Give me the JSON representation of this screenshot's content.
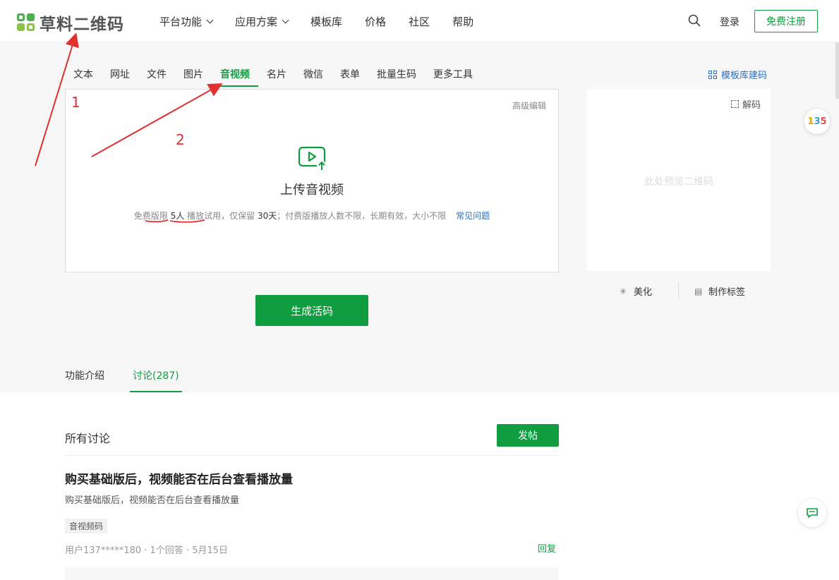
{
  "header": {
    "logo_text": "草料二维码",
    "nav": [
      {
        "label": "平台功能",
        "dropdown": true
      },
      {
        "label": "应用方案",
        "dropdown": true
      },
      {
        "label": "模板库",
        "dropdown": false
      },
      {
        "label": "价格",
        "dropdown": false
      },
      {
        "label": "社区",
        "dropdown": false
      },
      {
        "label": "帮助",
        "dropdown": false
      }
    ],
    "login": "登录",
    "register": "免费注册"
  },
  "type_tabs": [
    "文本",
    "网址",
    "文件",
    "图片",
    "音视频",
    "名片",
    "微信",
    "表单",
    "批量生码",
    "更多工具"
  ],
  "active_type_tab": "音视频",
  "template_link": "模板库建码",
  "upload": {
    "advanced_edit": "高级编辑",
    "title": "上传音视频",
    "note_prefix": "免费版限",
    "note_count": "5人",
    "note_rest": "播放试用，仅保留",
    "note_days": "30天",
    "note_paid": "；付费版播放人数不限，长期有效，大小不限",
    "faq": "常见问题"
  },
  "preview": {
    "decode": "解码",
    "placeholder": "此处预览二维码"
  },
  "actions": {
    "beautify": "美化",
    "make_label": "制作标签",
    "generate": "生成活码"
  },
  "lower_tabs": [
    "功能介绍",
    "讨论(287)"
  ],
  "discussion": {
    "heading": "所有讨论",
    "post_button": "发帖",
    "item": {
      "title": "购买基础版后，视频能否在后台查看播放量",
      "body": "购买基础版后，视频能否在后台查看播放量",
      "tag": "音视频码",
      "meta": "用户137*****180 · 1个回答 · 5月15日",
      "reply": "回复"
    }
  },
  "annotations": {
    "n1": "1",
    "n2": "2"
  },
  "floating": {
    "badge_1": "1",
    "badge_3": "3",
    "badge_5": "5"
  },
  "colors": {
    "brand_green": "#0f9d40",
    "link_blue": "#2b6fbe",
    "annotation_red": "#e03030"
  }
}
